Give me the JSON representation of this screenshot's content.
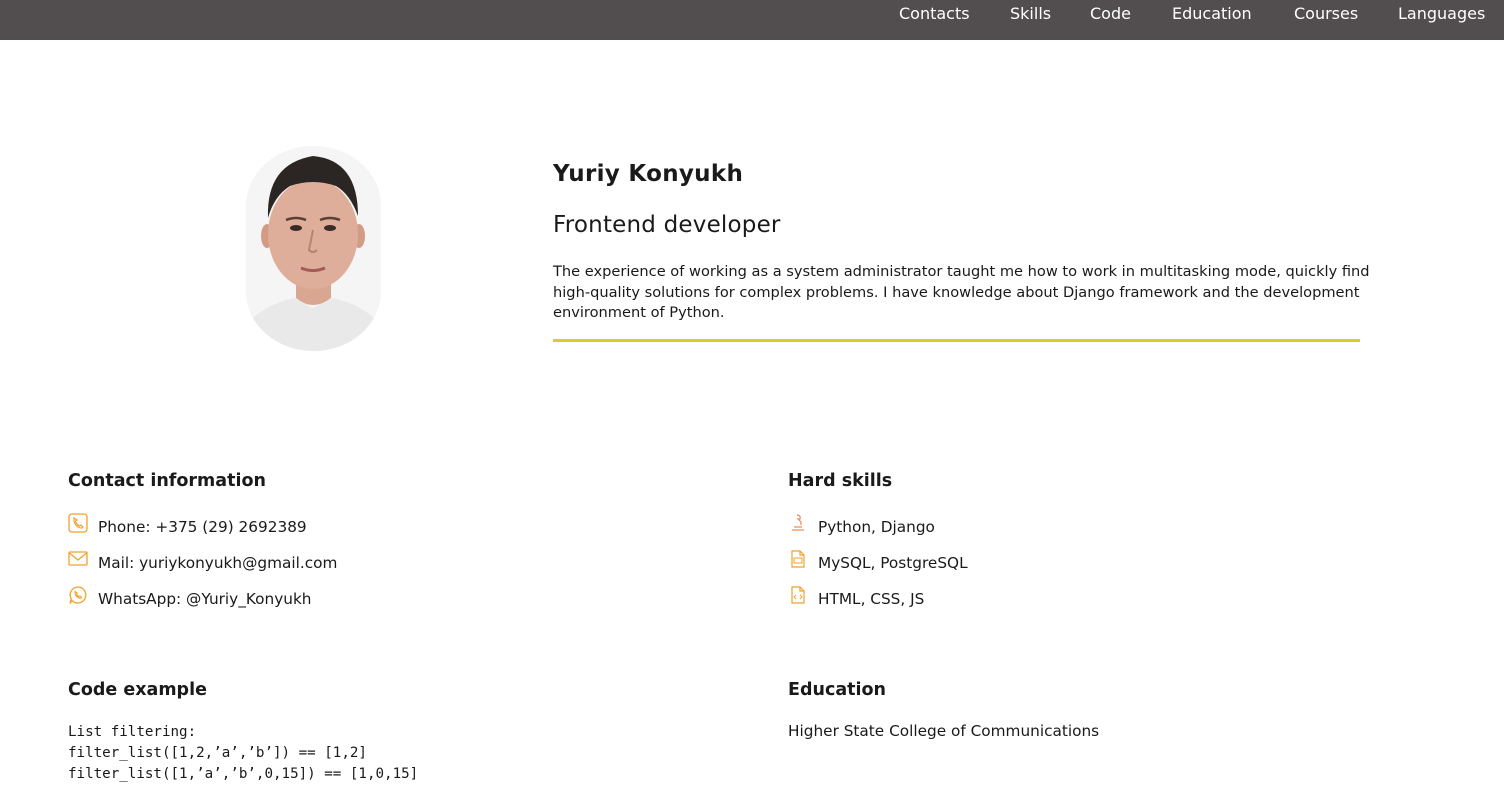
{
  "nav": {
    "items": [
      {
        "label": "Contacts"
      },
      {
        "label": "Skills"
      },
      {
        "label": "Code"
      },
      {
        "label": "Education"
      },
      {
        "label": "Courses"
      },
      {
        "label": "Languages"
      }
    ]
  },
  "profile": {
    "name": "Yuriy Konyukh",
    "role": "Frontend developer",
    "about": "The experience of working as a system administrator taught me how to work in multitasking mode, quickly find high-quality solutions for complex problems. I have knowledge about Django framework and the development environment of Python."
  },
  "contacts": {
    "title": "Contact information",
    "items": [
      {
        "text": "Phone: +375 (29) 2692389",
        "icon": "phone-icon"
      },
      {
        "text": "Mail: yuriykonyukh@gmail.com",
        "icon": "mail-icon"
      },
      {
        "text": "WhatsApp: @Yuriy_Konyukh",
        "icon": "whatsapp-icon"
      }
    ]
  },
  "skills": {
    "title": "Hard skills",
    "items": [
      {
        "text": "Python, Django",
        "icon": "python-icon"
      },
      {
        "text": "MySQL, PostgreSQL",
        "icon": "sql-file-icon"
      },
      {
        "text": "HTML, CSS, JS",
        "icon": "html-file-icon"
      }
    ]
  },
  "code": {
    "title": "Code example",
    "text": "List filtering:\nfilter_list([1,2,’a’,’b’]) == [1,2]\nfilter_list([1,’a’,’b’,0,15]) == [1,0,15]"
  },
  "education": {
    "title": "Education",
    "text": "Higher State College of Communications"
  },
  "colors": {
    "nav_bg": "#524d4e",
    "accent": "#dfca2e",
    "icon_orange": "#f0a22e"
  }
}
